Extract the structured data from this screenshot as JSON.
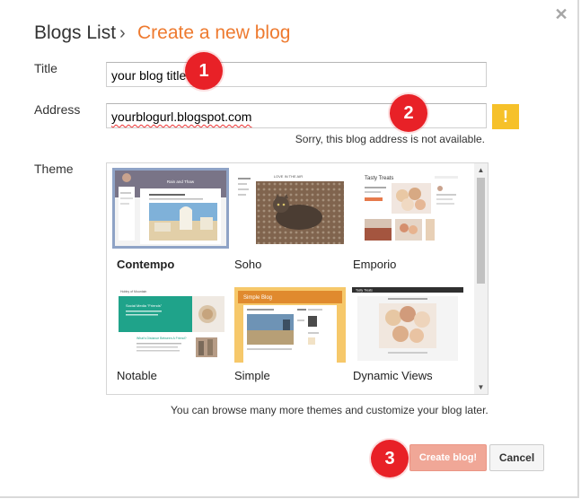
{
  "header": {
    "root": "Blogs List",
    "separator": "›",
    "current": "Create a new blog",
    "close_glyph": "✕"
  },
  "form": {
    "title_label": "Title",
    "title_value": "your blog title",
    "address_label": "Address",
    "address_value": "yourblogurl.blogspot.com",
    "warning_glyph": "!",
    "address_error": "Sorry, this blog address is not available.",
    "theme_label": "Theme"
  },
  "themes": [
    {
      "name": "Contempo",
      "selected": true
    },
    {
      "name": "Soho",
      "selected": false
    },
    {
      "name": "Emporio",
      "selected": false
    },
    {
      "name": "Notable",
      "selected": false
    },
    {
      "name": "Simple",
      "selected": false
    },
    {
      "name": "Dynamic Views",
      "selected": false
    }
  ],
  "theme_previews": {
    "contempo_caption": "Rain and Thaw",
    "soho_caption": "LOVE IN THE AIR",
    "emporio_title": "Tasty Treats",
    "notable_small": "Hobby of Mountain",
    "notable_head": "Social Media \"Friends\"",
    "notable_article": "What's Distance Between A Friend?",
    "simple_title": "Simple Blog",
    "dv_title": "Tasty Treats"
  },
  "footer": {
    "note": "You can browse many more themes and customize your blog later.",
    "create_label": "Create blog!",
    "cancel_label": "Cancel"
  },
  "annotations": [
    "1",
    "2",
    "3"
  ],
  "colors": {
    "accent": "#ee7a2f",
    "warning": "#f6c12a",
    "marker": "#e82127",
    "create_button": "#f0a797",
    "selection": "#8fa3c6"
  }
}
